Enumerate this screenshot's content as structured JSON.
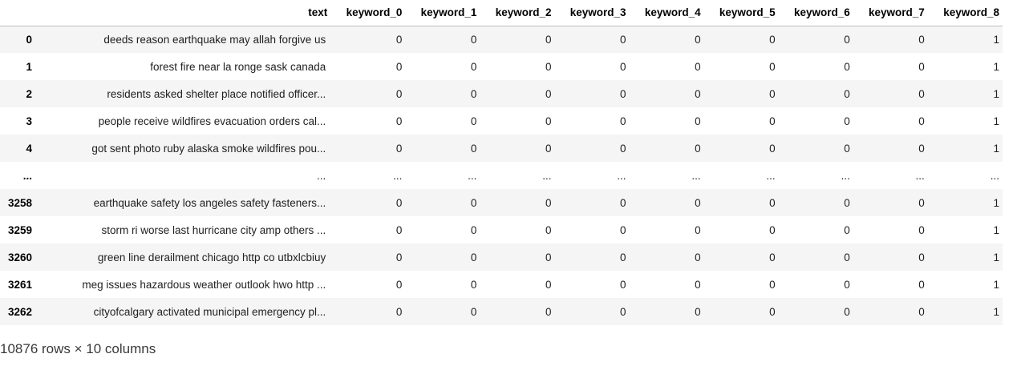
{
  "dataframe": {
    "columns": [
      "text",
      "keyword_0",
      "keyword_1",
      "keyword_2",
      "keyword_3",
      "keyword_4",
      "keyword_5",
      "keyword_6",
      "keyword_7",
      "keyword_8"
    ],
    "rows": [
      {
        "index": "0",
        "text": "deeds reason earthquake may allah forgive us",
        "values": [
          "0",
          "0",
          "0",
          "0",
          "0",
          "0",
          "0",
          "0",
          "1"
        ]
      },
      {
        "index": "1",
        "text": "forest fire near la ronge sask canada",
        "values": [
          "0",
          "0",
          "0",
          "0",
          "0",
          "0",
          "0",
          "0",
          "1"
        ]
      },
      {
        "index": "2",
        "text": "residents asked shelter place notified officer...",
        "values": [
          "0",
          "0",
          "0",
          "0",
          "0",
          "0",
          "0",
          "0",
          "1"
        ]
      },
      {
        "index": "3",
        "text": "people receive wildfires evacuation orders cal...",
        "values": [
          "0",
          "0",
          "0",
          "0",
          "0",
          "0",
          "0",
          "0",
          "1"
        ]
      },
      {
        "index": "4",
        "text": "got sent photo ruby alaska smoke wildfires pou...",
        "values": [
          "0",
          "0",
          "0",
          "0",
          "0",
          "0",
          "0",
          "0",
          "1"
        ]
      },
      {
        "index": "...",
        "text": "...",
        "values": [
          "...",
          "...",
          "...",
          "...",
          "...",
          "...",
          "...",
          "...",
          "..."
        ]
      },
      {
        "index": "3258",
        "text": "earthquake safety los angeles safety fasteners...",
        "values": [
          "0",
          "0",
          "0",
          "0",
          "0",
          "0",
          "0",
          "0",
          "1"
        ]
      },
      {
        "index": "3259",
        "text": "storm ri worse last hurricane city amp others ...",
        "values": [
          "0",
          "0",
          "0",
          "0",
          "0",
          "0",
          "0",
          "0",
          "1"
        ]
      },
      {
        "index": "3260",
        "text": "green line derailment chicago http co utbxlcbiuy",
        "values": [
          "0",
          "0",
          "0",
          "0",
          "0",
          "0",
          "0",
          "0",
          "1"
        ]
      },
      {
        "index": "3261",
        "text": "meg issues hazardous weather outlook hwo http ...",
        "values": [
          "0",
          "0",
          "0",
          "0",
          "0",
          "0",
          "0",
          "0",
          "1"
        ]
      },
      {
        "index": "3262",
        "text": "cityofcalgary activated municipal emergency pl...",
        "values": [
          "0",
          "0",
          "0",
          "0",
          "0",
          "0",
          "0",
          "0",
          "1"
        ]
      }
    ],
    "shape_text": "10876 rows × 10 columns"
  }
}
